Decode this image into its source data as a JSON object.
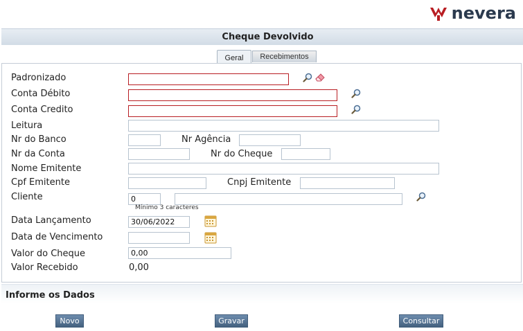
{
  "brand": {
    "logo_text": "nevera",
    "logo_color": "#b81d22"
  },
  "page_title": "Cheque Devolvido",
  "tabs": [
    {
      "label": "Geral",
      "active": true
    },
    {
      "label": "Recebimentos",
      "active": false
    }
  ],
  "form": {
    "padronizado": {
      "label": "Padronizado",
      "value": ""
    },
    "conta_debito": {
      "label": "Conta Débito",
      "value": ""
    },
    "conta_credito": {
      "label": "Conta Credito",
      "value": ""
    },
    "leitura": {
      "label": "Leitura",
      "value": ""
    },
    "nr_banco": {
      "label": "Nr do Banco",
      "value": ""
    },
    "nr_agencia": {
      "label": "Nr Agência",
      "value": ""
    },
    "nr_conta": {
      "label": "Nr da Conta",
      "value": ""
    },
    "nr_cheque": {
      "label": "Nr do Cheque",
      "value": ""
    },
    "nome_emitente": {
      "label": "Nome Emitente",
      "value": ""
    },
    "cpf_emitente": {
      "label": "Cpf Emitente",
      "value": ""
    },
    "cnpj_emitente": {
      "label": "Cnpj Emitente",
      "value": ""
    },
    "cliente": {
      "label": "Cliente",
      "code": "0",
      "name": "",
      "hint": "Mínimo 3 caracteres"
    },
    "data_lancamento": {
      "label": "Data Lançamento",
      "value": "30/06/2022"
    },
    "data_vencimento": {
      "label": "Data de Vencimento",
      "value": ""
    },
    "valor_cheque": {
      "label": "Valor do Cheque",
      "value": "0,00"
    },
    "valor_recebido": {
      "label": "Valor Recebido",
      "value": "0,00"
    }
  },
  "section_title": "Informe os Dados",
  "buttons": {
    "novo": "Novo",
    "gravar": "Gravar",
    "consultar": "Consultar"
  },
  "icons": {
    "search": "magnifier-icon",
    "eraser": "eraser-icon",
    "calendar": "calendar-icon"
  }
}
